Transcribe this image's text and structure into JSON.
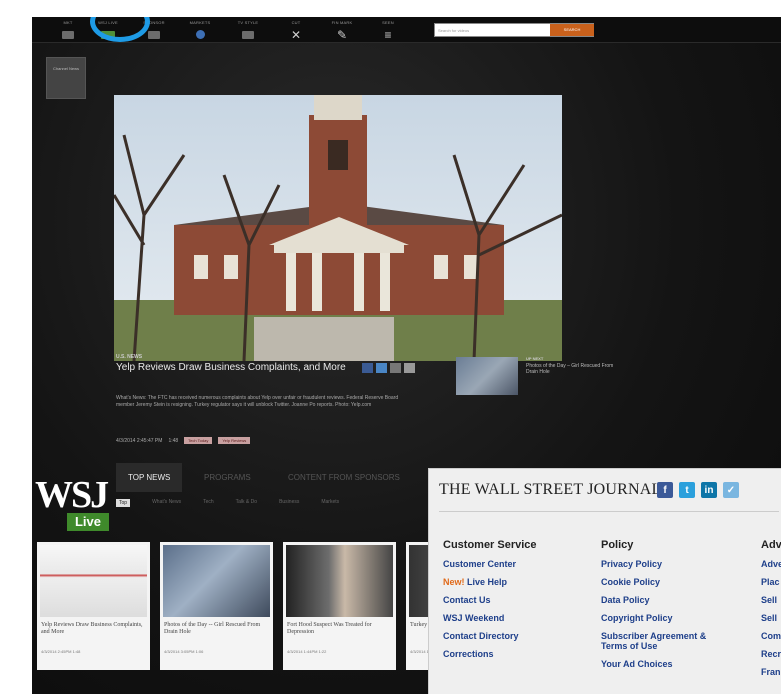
{
  "nav": {
    "items": [
      {
        "label": "Mkt",
        "icon": "tv-icon"
      },
      {
        "label": "Wsj Live",
        "icon": "live-icon"
      },
      {
        "label": "Sponsor",
        "icon": "doc-icon"
      },
      {
        "label": "Markets",
        "icon": "globe-icon"
      },
      {
        "label": "Tv Style",
        "icon": "tv-icon"
      },
      {
        "label": "Cut",
        "icon": "close-icon",
        "glyph": "✕"
      },
      {
        "label": "Fin Mark",
        "icon": "pencil-icon",
        "glyph": "✎"
      },
      {
        "label": "Seen",
        "icon": "menu-icon",
        "glyph": "≡"
      }
    ],
    "search_placeholder": "Search for videos",
    "search_button": "SEARCH"
  },
  "channel_label": "Channel News",
  "story": {
    "kicker": "U.S. NEWS",
    "headline": "Yelp Reviews Draw Business Complaints, and More",
    "summary": "What's News: The FTC has received numerous complaints about Yelp over unfair or fraudulent reviews. Federal Reserve Board member Jeremy Stein is resigning. Turkey regulator says it will unblock Twitter. Joanne Po reports. Photo: Yelp.com",
    "timestamp": "4/3/2014 2:45:47 PM",
    "duration": "1:48",
    "tag1": "Tech Today",
    "tag2": "Yelp Reviews"
  },
  "up_next": {
    "kicker": "UP NEXT",
    "title": "Photos of the Day – Girl Rescued From Drain Hole"
  },
  "wsj_live": {
    "logo": "WSJ",
    "live": "Live",
    "tabs": [
      "TOP NEWS",
      "PROGRAMS",
      "CONTENT FROM SPONSORS"
    ],
    "subtabs": [
      "Top",
      "What's News",
      "Tech",
      "Talk & Do",
      "Business",
      "Markets"
    ]
  },
  "cards": [
    {
      "caption": "Yelp Reviews Draw Business Complaints, and More",
      "time": "4/3/2014 2:45PM  1:48"
    },
    {
      "caption": "Photos of the Day -- Girl Rescued From Drain Hole",
      "time": "4/3/2014 3:05PM  1:06"
    },
    {
      "caption": "Fort Hood Suspect Was Treated for Depression",
      "time": "4/3/2014 1:44PM  1:22"
    },
    {
      "caption": "Turkey Regulator Unblock Twitter",
      "time": "4/3/2014 12:0"
    }
  ],
  "footer": {
    "title": "THE WALL STREET JOURNAL.",
    "columns": [
      {
        "heading": "Customer Service",
        "links": [
          {
            "text": "Customer Center",
            "prefix": ""
          },
          {
            "text": " Live Help",
            "prefix": "New!"
          },
          {
            "text": "Contact Us",
            "prefix": ""
          },
          {
            "text": "WSJ Weekend",
            "prefix": ""
          },
          {
            "text": "Contact Directory",
            "prefix": ""
          },
          {
            "text": "Corrections",
            "prefix": ""
          }
        ]
      },
      {
        "heading": "Policy",
        "links": [
          {
            "text": "Privacy Policy",
            "prefix": ""
          },
          {
            "text": "Cookie Policy",
            "prefix": ""
          },
          {
            "text": "Data Policy",
            "prefix": ""
          },
          {
            "text": "Copyright Policy",
            "prefix": ""
          },
          {
            "text": "Subscriber Agreement & Terms of Use",
            "prefix": ""
          },
          {
            "text": "Your Ad Choices",
            "prefix": ""
          }
        ]
      },
      {
        "heading": "Adv",
        "links": [
          {
            "text": "Adve",
            "prefix": ""
          },
          {
            "text": "Plac",
            "prefix": ""
          },
          {
            "text": "Sell",
            "prefix": ""
          },
          {
            "text": "Sell",
            "prefix": ""
          },
          {
            "text": "Com",
            "prefix": ""
          },
          {
            "text": "Recr",
            "prefix": ""
          },
          {
            "text": "Fran",
            "prefix": ""
          }
        ]
      }
    ]
  },
  "colors": {
    "live_green": "#3f8a2b",
    "search_orange": "#c9611c",
    "highlight": "#1e9be6",
    "link": "#1e3f8a"
  }
}
